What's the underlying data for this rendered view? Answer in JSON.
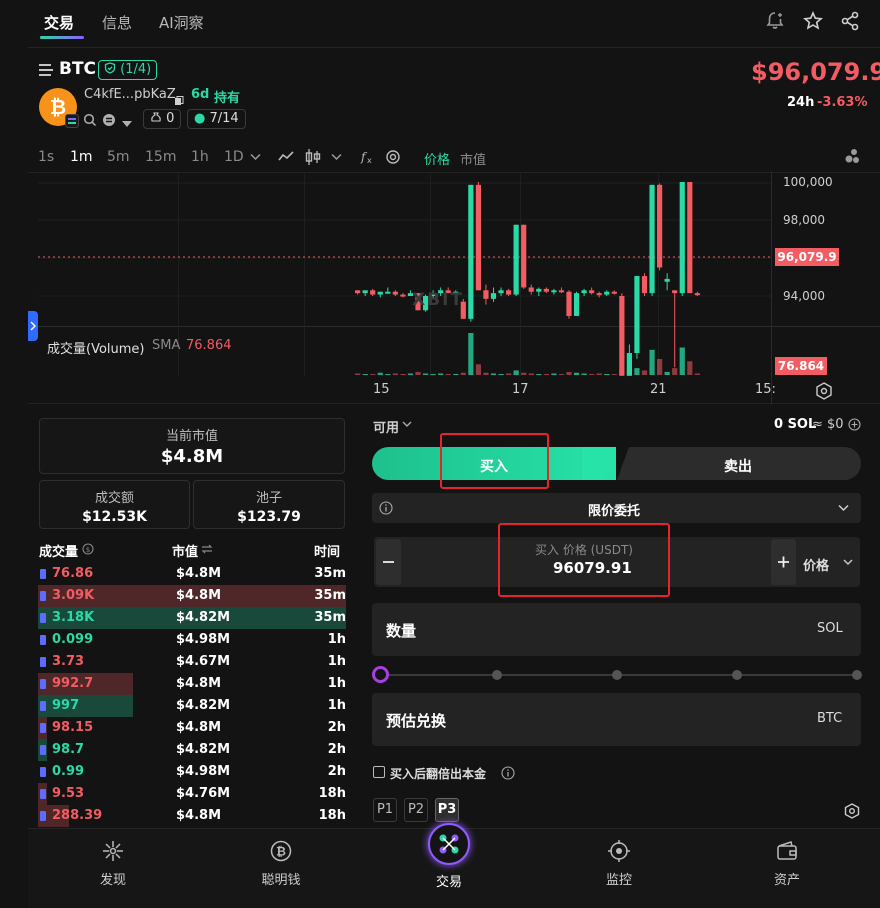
{
  "top_tabs": [
    {
      "label": "交易",
      "active": true
    },
    {
      "label": "信息",
      "active": false
    },
    {
      "label": "AI洞察",
      "active": false
    }
  ],
  "token": {
    "symbol": "BTC",
    "badge": "(1/4)",
    "address": "C4kfE...pbKaZ",
    "age": "6d",
    "holding": "持有",
    "bag_count": "0",
    "ratio": "7/14",
    "price": "$96,079.9",
    "period": "24h",
    "change": "-3.63%"
  },
  "timeframes": [
    "1s",
    "1m",
    "5m",
    "15m",
    "1h",
    "1D"
  ],
  "active_timeframe": "1m",
  "chart_mode": {
    "price_label": "价格",
    "market_label": "市值"
  },
  "chart_data": {
    "type": "candlestick",
    "y_ticks": [
      "100,000",
      "98,000",
      "96,000",
      "94,000"
    ],
    "x_ticks": [
      "15",
      "17",
      "21",
      "15:"
    ],
    "current_price_label": "96,079.9",
    "volume_title": "成交量(Volume)",
    "volume_indicator": "SMA",
    "volume_sma": "76.864",
    "volume_tag": "76.864",
    "watermark": "XBIT",
    "colors": {
      "up": "#2bd9a6",
      "down": "#f25c62"
    },
    "candles": [
      {
        "o": 96200,
        "h": 96200,
        "l": 96050,
        "c": 96100
      },
      {
        "o": 96100,
        "h": 96150,
        "l": 96000,
        "c": 96200
      },
      {
        "o": 96200,
        "h": 96250,
        "l": 96000,
        "c": 96050
      },
      {
        "o": 96050,
        "h": 96150,
        "l": 95950,
        "c": 96150
      },
      {
        "o": 96150,
        "h": 96300,
        "l": 96100,
        "c": 96150
      },
      {
        "o": 96150,
        "h": 96200,
        "l": 96000,
        "c": 96050
      },
      {
        "o": 96050,
        "h": 96100,
        "l": 95950,
        "c": 96000
      },
      {
        "o": 96000,
        "h": 96200,
        "l": 96000,
        "c": 96100
      },
      {
        "o": 96100,
        "h": 96100,
        "l": 95500,
        "c": 95500
      },
      {
        "o": 95500,
        "h": 96050,
        "l": 95450,
        "c": 96000
      },
      {
        "o": 96000,
        "h": 96200,
        "l": 95900,
        "c": 96100
      },
      {
        "o": 96100,
        "h": 96300,
        "l": 96000,
        "c": 96200
      },
      {
        "o": 96200,
        "h": 96300,
        "l": 96100,
        "c": 96100
      },
      {
        "o": 96100,
        "h": 96200,
        "l": 96000,
        "c": 96150
      },
      {
        "o": 95800,
        "h": 95900,
        "l": 95200,
        "c": 95200
      },
      {
        "o": 95200,
        "h": 99900,
        "l": 95100,
        "c": 99900
      },
      {
        "o": 99900,
        "h": 100000,
        "l": 96200,
        "c": 96200
      },
      {
        "o": 96200,
        "h": 96400,
        "l": 95700,
        "c": 95900
      },
      {
        "o": 95900,
        "h": 96300,
        "l": 95800,
        "c": 96100
      },
      {
        "o": 96100,
        "h": 96300,
        "l": 96000,
        "c": 96200
      },
      {
        "o": 96200,
        "h": 96250,
        "l": 96000,
        "c": 96050
      },
      {
        "o": 96050,
        "h": 98500,
        "l": 96000,
        "c": 98500
      },
      {
        "o": 98500,
        "h": 98500,
        "l": 96250,
        "c": 96300
      },
      {
        "o": 96300,
        "h": 96400,
        "l": 96050,
        "c": 96150
      },
      {
        "o": 96150,
        "h": 96300,
        "l": 96000,
        "c": 96250
      },
      {
        "o": 96250,
        "h": 96300,
        "l": 96100,
        "c": 96150
      },
      {
        "o": 96150,
        "h": 96250,
        "l": 96050,
        "c": 96200
      },
      {
        "o": 96200,
        "h": 96300,
        "l": 96100,
        "c": 96150
      },
      {
        "o": 96150,
        "h": 96200,
        "l": 95200,
        "c": 95300
      },
      {
        "o": 95300,
        "h": 96150,
        "l": 95300,
        "c": 96100
      },
      {
        "o": 96100,
        "h": 96250,
        "l": 96000,
        "c": 96200
      },
      {
        "o": 96200,
        "h": 96300,
        "l": 96050,
        "c": 96100
      },
      {
        "o": 96100,
        "h": 96150,
        "l": 95950,
        "c": 96050
      },
      {
        "o": 96050,
        "h": 96200,
        "l": 96000,
        "c": 96150
      },
      {
        "o": 96150,
        "h": 96200,
        "l": 96050,
        "c": 96100
      },
      {
        "o": 96000,
        "h": 96100,
        "l": 93200,
        "c": 93200
      },
      {
        "o": 93200,
        "h": 94300,
        "l": 93200,
        "c": 94000
      },
      {
        "o": 94000,
        "h": 96700,
        "l": 93800,
        "c": 96700
      },
      {
        "o": 96700,
        "h": 96800,
        "l": 96000,
        "c": 96100
      },
      {
        "o": 96100,
        "h": 99900,
        "l": 96000,
        "c": 99900
      },
      {
        "o": 99900,
        "h": 99950,
        "l": 96900,
        "c": 97000
      },
      {
        "o": 96500,
        "h": 96800,
        "l": 96200,
        "c": 96600
      },
      {
        "o": 96200,
        "h": 96200,
        "l": 93500,
        "c": 96100
      },
      {
        "o": 96100,
        "h": 100000,
        "l": 96000,
        "c": 100000
      },
      {
        "o": 100000,
        "h": 100000,
        "l": 96100,
        "c": 96100
      },
      {
        "o": 96100,
        "h": 96150,
        "l": 96000,
        "c": 96079.9
      }
    ],
    "volumes": [
      2,
      1,
      1,
      3,
      1,
      2,
      1,
      2,
      4,
      2,
      1,
      2,
      1,
      1,
      3,
      55,
      14,
      3,
      2,
      1,
      2,
      6,
      3,
      2,
      1,
      1,
      2,
      1,
      4,
      3,
      2,
      1,
      2,
      1,
      1,
      7,
      5,
      9,
      6,
      33,
      21,
      4,
      9,
      36,
      18,
      2
    ]
  },
  "stats": {
    "market_cap_label": "当前市值",
    "market_cap": "$4.8M",
    "turnover_label": "成交额",
    "turnover": "$12.53K",
    "pool_label": "池子",
    "pool": "$123.79"
  },
  "trades": {
    "headers": {
      "volume": "成交量",
      "market": "市值",
      "time": "时间"
    },
    "rows": [
      {
        "vol": "76.86",
        "mk": "$4.8M",
        "tm": "35m",
        "side": "sell",
        "bar": 0
      },
      {
        "vol": "3.09K",
        "mk": "$4.8M",
        "tm": "35m",
        "side": "sell",
        "bar": 1.0
      },
      {
        "vol": "3.18K",
        "mk": "$4.82M",
        "tm": "35m",
        "side": "buy",
        "bar": 1.0
      },
      {
        "vol": "0.099",
        "mk": "$4.98M",
        "tm": "1h",
        "side": "buy",
        "bar": 0
      },
      {
        "vol": "3.73",
        "mk": "$4.67M",
        "tm": "1h",
        "side": "sell",
        "bar": 0
      },
      {
        "vol": "992.7",
        "mk": "$4.8M",
        "tm": "1h",
        "side": "sell",
        "bar": 0.31
      },
      {
        "vol": "997",
        "mk": "$4.82M",
        "tm": "1h",
        "side": "buy",
        "bar": 0.31
      },
      {
        "vol": "98.15",
        "mk": "$4.8M",
        "tm": "2h",
        "side": "sell",
        "bar": 0.03
      },
      {
        "vol": "98.7",
        "mk": "$4.82M",
        "tm": "2h",
        "side": "buy",
        "bar": 0.03
      },
      {
        "vol": "0.99",
        "mk": "$4.98M",
        "tm": "2h",
        "side": "buy",
        "bar": 0
      },
      {
        "vol": "9.53",
        "mk": "$4.76M",
        "tm": "18h",
        "side": "sell",
        "bar": 0.03
      },
      {
        "vol": "288.39",
        "mk": "$4.8M",
        "tm": "18h",
        "side": "sell",
        "bar": 0.1
      }
    ]
  },
  "order": {
    "available_label": "可用",
    "balance": "0 SOL",
    "balance_usd": "≈ $0",
    "buy_label": "买入",
    "sell_label": "卖出",
    "order_type": "限价委托",
    "price_label": "买入 价格 (USDT)",
    "price_value": "96079.91",
    "price_mode": "价格",
    "qty_label": "数量",
    "qty_unit": "SOL",
    "slider_value": 0,
    "estimate_label": "预估兑换",
    "estimate_unit": "BTC",
    "double_label": "买入后翻倍出本金",
    "presets": [
      "P1",
      "P2",
      "P3"
    ],
    "active_preset": "P3"
  },
  "bottom_nav": [
    {
      "label": "发现",
      "icon": "discover-icon"
    },
    {
      "label": "聪明钱",
      "icon": "smart-money-icon"
    },
    {
      "label": "交易",
      "icon": "trade-icon"
    },
    {
      "label": "监控",
      "icon": "monitor-icon"
    },
    {
      "label": "资产",
      "icon": "wallet-icon"
    }
  ]
}
